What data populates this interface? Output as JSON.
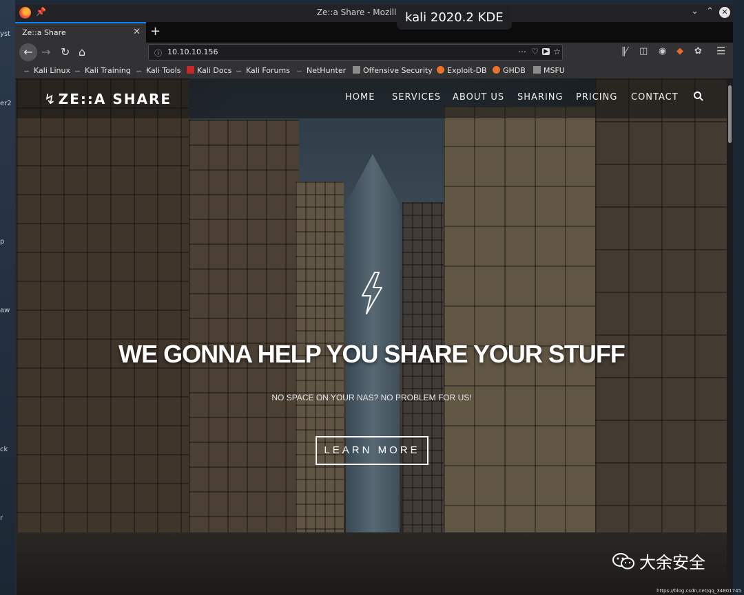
{
  "desktop": {
    "left_labels": [
      "yst",
      "er2",
      "p",
      "aw",
      "ck",
      "r"
    ]
  },
  "window": {
    "title": "Ze::a Share - Mozilla Firefox",
    "overlay_badge": "kali 2020.2 KDE"
  },
  "tabs": [
    {
      "label": "Ze::a Share",
      "active": true
    }
  ],
  "urlbar": {
    "url": "10.10.10.156"
  },
  "bookmarks": [
    {
      "label": "Kali Linux",
      "icon": "kali-dragon-icon"
    },
    {
      "label": "Kali Training",
      "icon": "kali-dragon-icon"
    },
    {
      "label": "Kali Tools",
      "icon": "kali-dragon-icon"
    },
    {
      "label": "Kali Docs",
      "icon": "red-book-icon"
    },
    {
      "label": "Kali Forums",
      "icon": "kali-dragon-icon"
    },
    {
      "label": "NetHunter",
      "icon": "kali-dragon-icon"
    },
    {
      "label": "Offensive Security",
      "icon": "offsec-icon"
    },
    {
      "label": "Exploit-DB",
      "icon": "orange-flame-icon"
    },
    {
      "label": "GHDB",
      "icon": "orange-flame-icon"
    },
    {
      "label": "MSFU",
      "icon": "offsec-icon"
    }
  ],
  "site": {
    "brand": "ZE::A SHARE",
    "nav": [
      "HOME",
      "SERVICES",
      "ABOUT US",
      "SHARING",
      "PRICING",
      "CONTACT"
    ],
    "hero_title": "WE GONNA HELP YOU SHARE YOUR STUFF",
    "hero_subtitle": "NO SPACE ON YOUR NAS? NO PROBLEM FOR US!",
    "cta_label": "LEARN MORE"
  },
  "watermark": {
    "text": "大余安全",
    "url": "https://blog.csdn.net/qq_34801745"
  }
}
